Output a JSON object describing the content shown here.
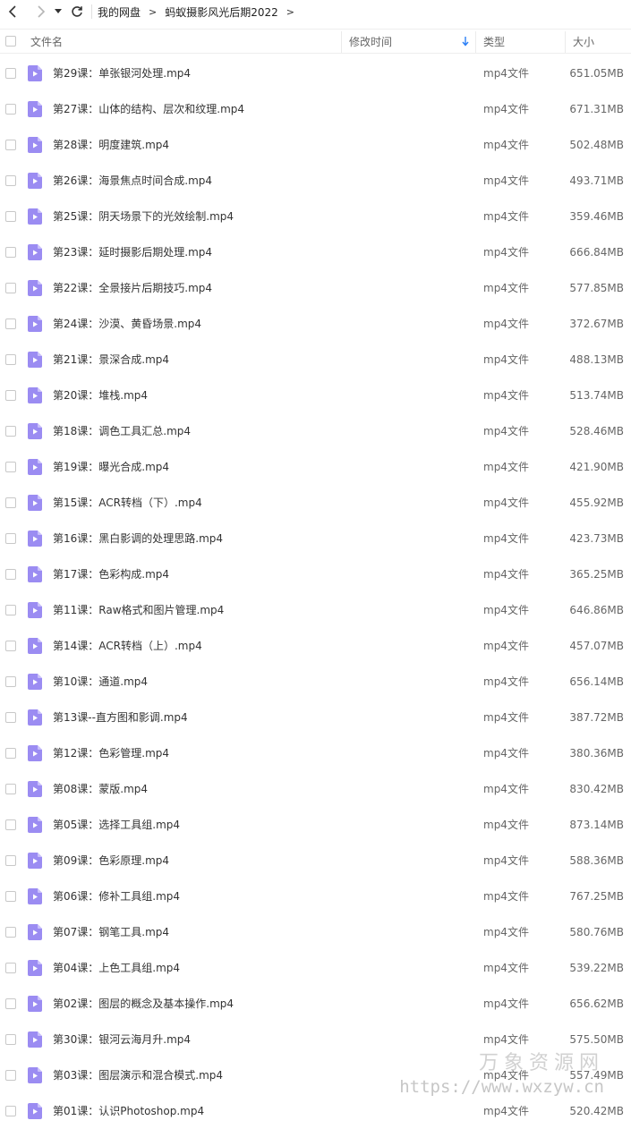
{
  "breadcrumb": {
    "root": "我的网盘",
    "folder": "蚂蚁摄影风光后期2022",
    "separator": ">"
  },
  "columns": {
    "name": "文件名",
    "modified": "修改时间",
    "type": "类型",
    "size": "大小"
  },
  "colors": {
    "icon": "#9b8cf2",
    "sort_arrow": "#2a7ff6"
  },
  "files": [
    {
      "name": "第29课：单张银河处理.mp4",
      "type": "mp4文件",
      "size": "651.05MB"
    },
    {
      "name": "第27课：山体的结构、层次和纹理.mp4",
      "type": "mp4文件",
      "size": "671.31MB"
    },
    {
      "name": "第28课：明度建筑.mp4",
      "type": "mp4文件",
      "size": "502.48MB"
    },
    {
      "name": "第26课：海景焦点时间合成.mp4",
      "type": "mp4文件",
      "size": "493.71MB"
    },
    {
      "name": "第25课：阴天场景下的光效绘制.mp4",
      "type": "mp4文件",
      "size": "359.46MB"
    },
    {
      "name": "第23课：延时摄影后期处理.mp4",
      "type": "mp4文件",
      "size": "666.84MB"
    },
    {
      "name": "第22课：全景接片后期技巧.mp4",
      "type": "mp4文件",
      "size": "577.85MB"
    },
    {
      "name": "第24课：沙漠、黄昏场景.mp4",
      "type": "mp4文件",
      "size": "372.67MB"
    },
    {
      "name": "第21课：景深合成.mp4",
      "type": "mp4文件",
      "size": "488.13MB"
    },
    {
      "name": "第20课：堆栈.mp4",
      "type": "mp4文件",
      "size": "513.74MB"
    },
    {
      "name": "第18课：调色工具汇总.mp4",
      "type": "mp4文件",
      "size": "528.46MB"
    },
    {
      "name": "第19课：曝光合成.mp4",
      "type": "mp4文件",
      "size": "421.90MB"
    },
    {
      "name": "第15课：ACR转档（下）.mp4",
      "type": "mp4文件",
      "size": "455.92MB"
    },
    {
      "name": "第16课：黑白影调的处理思路.mp4",
      "type": "mp4文件",
      "size": "423.73MB"
    },
    {
      "name": "第17课：色彩构成.mp4",
      "type": "mp4文件",
      "size": "365.25MB"
    },
    {
      "name": "第11课：Raw格式和图片管理.mp4",
      "type": "mp4文件",
      "size": "646.86MB"
    },
    {
      "name": "第14课：ACR转档（上）.mp4",
      "type": "mp4文件",
      "size": "457.07MB"
    },
    {
      "name": "第10课：通道.mp4",
      "type": "mp4文件",
      "size": "656.14MB"
    },
    {
      "name": "第13课--直方图和影调.mp4",
      "type": "mp4文件",
      "size": "387.72MB"
    },
    {
      "name": "第12课：色彩管理.mp4",
      "type": "mp4文件",
      "size": "380.36MB"
    },
    {
      "name": "第08课：蒙版.mp4",
      "type": "mp4文件",
      "size": "830.42MB"
    },
    {
      "name": "第05课：选择工具组.mp4",
      "type": "mp4文件",
      "size": "873.14MB"
    },
    {
      "name": "第09课：色彩原理.mp4",
      "type": "mp4文件",
      "size": "588.36MB"
    },
    {
      "name": "第06课：修补工具组.mp4",
      "type": "mp4文件",
      "size": "767.25MB"
    },
    {
      "name": "第07课：钢笔工具.mp4",
      "type": "mp4文件",
      "size": "580.76MB"
    },
    {
      "name": "第04课：上色工具组.mp4",
      "type": "mp4文件",
      "size": "539.22MB"
    },
    {
      "name": "第02课：图层的概念及基本操作.mp4",
      "type": "mp4文件",
      "size": "656.62MB"
    },
    {
      "name": "第30课：银河云海月升.mp4",
      "type": "mp4文件",
      "size": "575.50MB"
    },
    {
      "name": "第03课：图层演示和混合模式.mp4",
      "type": "mp4文件",
      "size": "557.49MB"
    },
    {
      "name": "第01课：认识Photoshop.mp4",
      "type": "mp4文件",
      "size": "520.42MB"
    }
  ],
  "watermark": {
    "name": "万象资源网",
    "url": "https://www.wxzyw.cn"
  }
}
